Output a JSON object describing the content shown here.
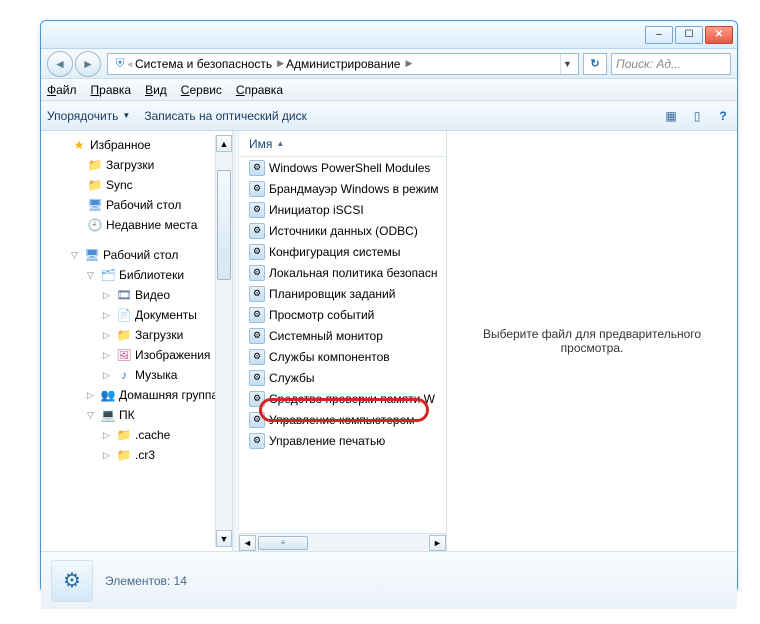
{
  "titlebar": {
    "min": "–",
    "max": "☐",
    "close": "✕"
  },
  "address": {
    "crumb1": "Система и безопасность",
    "crumb2": "Администрирование",
    "sep": "▶",
    "left_sep": "«",
    "drop": "▼",
    "refresh": "↻"
  },
  "search": {
    "placeholder": "Поиск: Ад..."
  },
  "menu": {
    "file": "Файл",
    "edit": "Правка",
    "view": "Вид",
    "tools": "Сервис",
    "help": "Справка"
  },
  "toolbar": {
    "organize": "Упорядочить",
    "burn": "Записать на оптический диск",
    "view_glyph": "▦",
    "preview_glyph": "▯",
    "help_glyph": "?"
  },
  "sidebar": {
    "favorites": "Избранное",
    "downloads": "Загрузки",
    "sync": "Sync",
    "desktop_fav": "Рабочий стол",
    "recent": "Недавние места",
    "desktop_root": "Рабочий стол",
    "libraries": "Библиотеки",
    "videos": "Видео",
    "documents": "Документы",
    "downloads2": "Загрузки",
    "pictures": "Изображения",
    "music": "Музыка",
    "homegroup": "Домашняя группа",
    "computer": "ПК",
    "cache": ".cache",
    "cr3": ".cr3"
  },
  "column": {
    "name": "Имя"
  },
  "files": [
    "Windows PowerShell Modules",
    "Брандмауэр Windows в режим",
    "Инициатор iSCSI",
    "Источники данных (ODBC)",
    "Конфигурация системы",
    "Локальная политика безопасн",
    "Планировщик заданий",
    "Просмотр событий",
    "Системный монитор",
    "Службы компонентов",
    "Службы",
    "Средство проверки памяти W",
    "Управление компьютером",
    "Управление печатью"
  ],
  "preview": {
    "text": "Выберите файл для предварительного просмотра."
  },
  "status": {
    "text": "Элементов: 14"
  }
}
